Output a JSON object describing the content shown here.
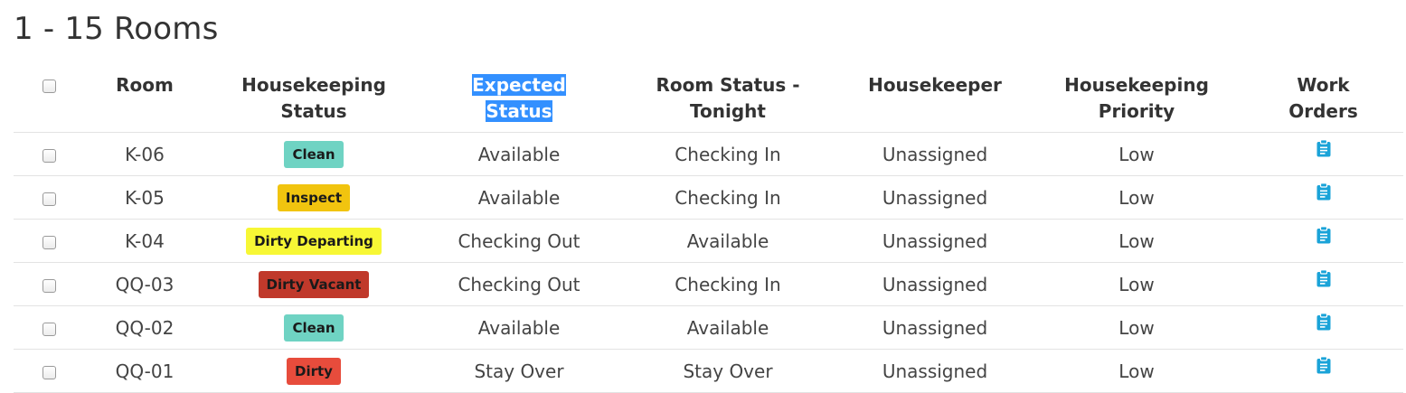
{
  "page": {
    "title": "1 - 15 Rooms"
  },
  "table": {
    "headers": {
      "room": "Room",
      "housekeeping_status_1": "Housekeeping",
      "housekeeping_status_2": "Status",
      "expected_status_1": "Expected",
      "expected_status_2": "Status",
      "room_status_tonight_1": "Room Status -",
      "room_status_tonight_2": "Tonight",
      "housekeeper": "Housekeeper",
      "housekeeping_priority_1": "Housekeeping",
      "housekeeping_priority_2": "Priority",
      "work_orders_1": "Work",
      "work_orders_2": "Orders"
    },
    "rows": [
      {
        "room": "K-06",
        "hk_status": "Clean",
        "expected": "Available",
        "tonight": "Checking In",
        "housekeeper": "Unassigned",
        "priority": "Low"
      },
      {
        "room": "K-05",
        "hk_status": "Inspect",
        "expected": "Available",
        "tonight": "Checking In",
        "housekeeper": "Unassigned",
        "priority": "Low"
      },
      {
        "room": "K-04",
        "hk_status": "Dirty Departing",
        "expected": "Checking Out",
        "tonight": "Available",
        "housekeeper": "Unassigned",
        "priority": "Low"
      },
      {
        "room": "QQ-03",
        "hk_status": "Dirty Vacant",
        "expected": "Checking Out",
        "tonight": "Checking In",
        "housekeeper": "Unassigned",
        "priority": "Low"
      },
      {
        "room": "QQ-02",
        "hk_status": "Clean",
        "expected": "Available",
        "tonight": "Available",
        "housekeeper": "Unassigned",
        "priority": "Low"
      },
      {
        "room": "QQ-01",
        "hk_status": "Dirty",
        "expected": "Stay Over",
        "tonight": "Stay Over",
        "housekeeper": "Unassigned",
        "priority": "Low"
      }
    ]
  },
  "colors": {
    "Clean": "#6fd3c3",
    "Inspect": "#f1c40f",
    "Dirty Departing": "#f7f735",
    "Dirty Vacant": "#c0392b",
    "Dirty": "#e74c3c",
    "icon": "#1aa3d8",
    "selection_highlight": "#3390ff"
  },
  "icons": {
    "work_order": "clipboard-icon"
  }
}
